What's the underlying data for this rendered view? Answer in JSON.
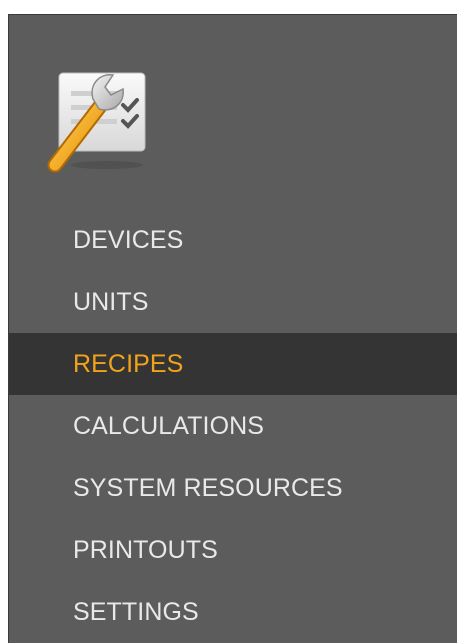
{
  "logo": {
    "icon": "settings-tools-icon"
  },
  "colors": {
    "sidebar_bg": "#5c5c5c",
    "active_bg": "#343434",
    "active_text": "#f0a31b",
    "text": "#e9e9e9"
  },
  "nav": {
    "active_index": 2,
    "items": [
      {
        "label": "DEVICES"
      },
      {
        "label": "UNITS"
      },
      {
        "label": "RECIPES"
      },
      {
        "label": "CALCULATIONS"
      },
      {
        "label": "SYSTEM RESOURCES"
      },
      {
        "label": "PRINTOUTS"
      },
      {
        "label": "SETTINGS"
      }
    ]
  }
}
